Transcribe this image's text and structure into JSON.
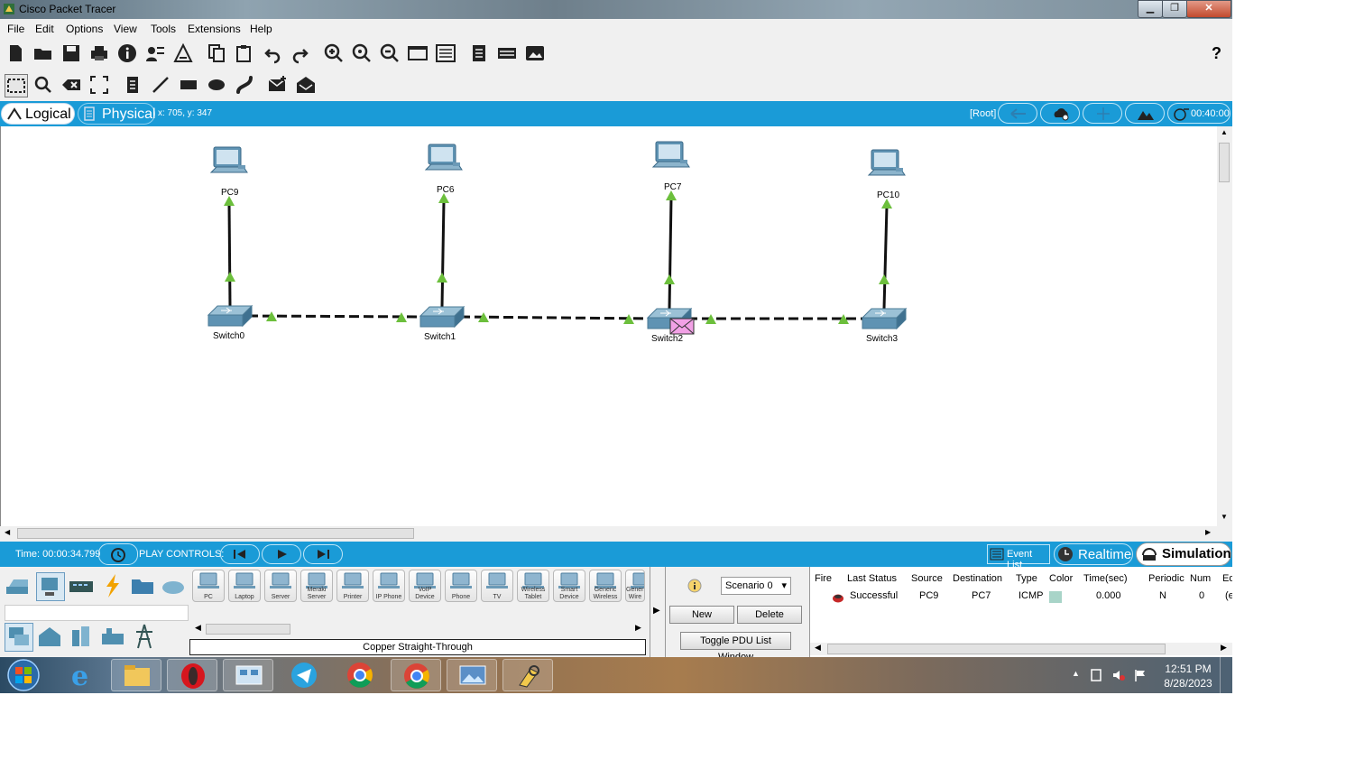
{
  "window": {
    "title": "Cisco Packet Tracer",
    "minimize": "▁",
    "maximize": "❐",
    "close": "✕"
  },
  "menu": [
    "File",
    "Edit",
    "Options",
    "View",
    "Tools",
    "Extensions",
    "Help"
  ],
  "toolbar": {
    "help_label": "?"
  },
  "workspace": {
    "logical_label": "Logical",
    "physical_label": "Physical",
    "coords": "x: 705, y: 347",
    "root_label": "[Root]",
    "sim_time": "00:40:00"
  },
  "topology": {
    "devices": [
      {
        "id": "pc9",
        "type": "pc",
        "label": "PC9"
      },
      {
        "id": "pc6",
        "type": "pc",
        "label": "PC6"
      },
      {
        "id": "pc7",
        "type": "pc",
        "label": "PC7"
      },
      {
        "id": "pc10",
        "type": "pc",
        "label": "PC10"
      },
      {
        "id": "switch0",
        "type": "switch",
        "label": "Switch0"
      },
      {
        "id": "switch1",
        "type": "switch",
        "label": "Switch1"
      },
      {
        "id": "switch2",
        "type": "switch",
        "label": "Switch2"
      },
      {
        "id": "switch3",
        "type": "switch",
        "label": "Switch3"
      }
    ],
    "links": [
      {
        "from": "pc9",
        "to": "switch0",
        "style": "straight-through"
      },
      {
        "from": "pc6",
        "to": "switch1",
        "style": "straight-through"
      },
      {
        "from": "pc7",
        "to": "switch2",
        "style": "straight-through"
      },
      {
        "from": "pc10",
        "to": "switch3",
        "style": "straight-through"
      },
      {
        "from": "switch0",
        "to": "switch1",
        "style": "crossover"
      },
      {
        "from": "switch1",
        "to": "switch2",
        "style": "crossover"
      },
      {
        "from": "switch2",
        "to": "switch3",
        "style": "crossover"
      }
    ],
    "link_status_color": "#6cbf3c",
    "pdu_envelope": {
      "at_device": "switch2",
      "color": "#f2a1e6"
    }
  },
  "simulation_bar": {
    "time": "Time: 00:00:34.799",
    "play_controls": "PLAY CONTROLS:",
    "event_list": "Event List",
    "realtime": "Realtime",
    "simulation": "Simulation"
  },
  "device_palette": {
    "devices": [
      "PC",
      "Laptop",
      "Server",
      "Meraki Server",
      "Printer",
      "IP Phone",
      "VoIP Device",
      "Phone",
      "TV",
      "Wireless Tablet",
      "Smart Device",
      "Generic Wireless",
      "Generic Wire"
    ],
    "selected_connection": "Copper Straight-Through"
  },
  "scenario": {
    "selected": "Scenario 0",
    "new_label": "New",
    "delete_label": "Delete",
    "toggle_label": "Toggle PDU List Window"
  },
  "pdu_table": {
    "headers": [
      "Fire",
      "Last Status",
      "Source",
      "Destination",
      "Type",
      "Color",
      "Time(sec)",
      "Periodic",
      "Num",
      "Ed"
    ],
    "rows": [
      {
        "last_status": "Successful",
        "source": "PC9",
        "destination": "PC7",
        "type": "ICMP",
        "color": "#a8d4c8",
        "time": "0.000",
        "periodic": "N",
        "num": "0",
        "edit": "(e"
      }
    ]
  },
  "taskbar": {
    "time": "12:51 PM",
    "date": "8/28/2023"
  }
}
